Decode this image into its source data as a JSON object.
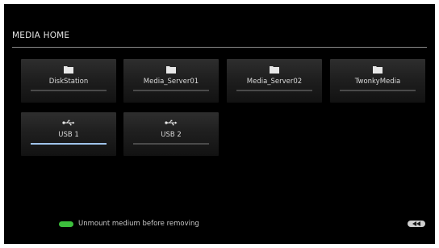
{
  "header": {
    "title": "MEDIA HOME"
  },
  "tiles": [
    {
      "label": "DiskStation",
      "icon": "folder-icon",
      "progress": 0
    },
    {
      "label": "Media_Server01",
      "icon": "folder-icon",
      "progress": 0
    },
    {
      "label": "Media_Server02",
      "icon": "folder-icon",
      "progress": 0
    },
    {
      "label": "TwonkyMedia",
      "icon": "folder-icon",
      "progress": 0
    },
    {
      "label": "USB 1",
      "icon": "usb-icon",
      "progress": 1.0,
      "selected": true
    },
    {
      "label": "USB 2",
      "icon": "usb-icon",
      "progress": 0
    }
  ],
  "footer": {
    "hint": "Unmount medium before removing",
    "hint_key_color": "#3cbf3c",
    "back_icon": "rewind-icon"
  },
  "colors": {
    "background": "#000000",
    "selected_bar": "#9fc3ea"
  }
}
